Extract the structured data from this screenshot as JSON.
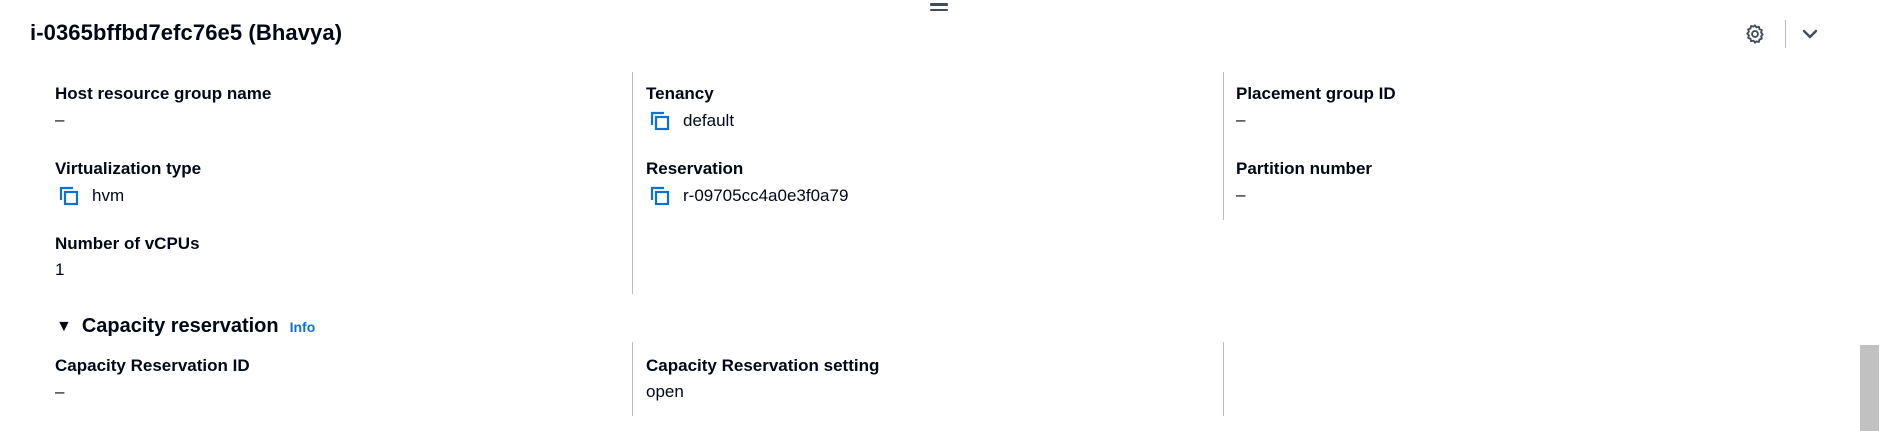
{
  "panel": {
    "title": "i-0365bffbd7efc76e5 (Bhavya)",
    "settings_icon": "gear-icon",
    "collapse_icon": "chevron-down-icon"
  },
  "details": {
    "col1": [
      {
        "key": "Host resource group name",
        "value": "–",
        "copyable": false
      },
      {
        "key": "Virtualization type",
        "value": "hvm",
        "copyable": true
      },
      {
        "key": "Number of vCPUs",
        "value": "1",
        "copyable": false
      }
    ],
    "col2": [
      {
        "key": "Tenancy",
        "value": "default",
        "copyable": true
      },
      {
        "key": "Reservation",
        "value": "r-09705cc4a0e3f0a79",
        "copyable": true
      }
    ],
    "col3": [
      {
        "key": "Placement group ID",
        "value": "–",
        "copyable": false
      },
      {
        "key": "Partition number",
        "value": "–",
        "copyable": false
      }
    ]
  },
  "capacity_section": {
    "title": "Capacity reservation",
    "info_link": "Info",
    "expanded": true,
    "items": [
      {
        "key": "Capacity Reservation ID",
        "value": "–"
      },
      {
        "key": "Capacity Reservation setting",
        "value": "open"
      }
    ]
  },
  "colors": {
    "text": "#000716",
    "link": "#0972d3",
    "divider": "#b6bec9"
  }
}
